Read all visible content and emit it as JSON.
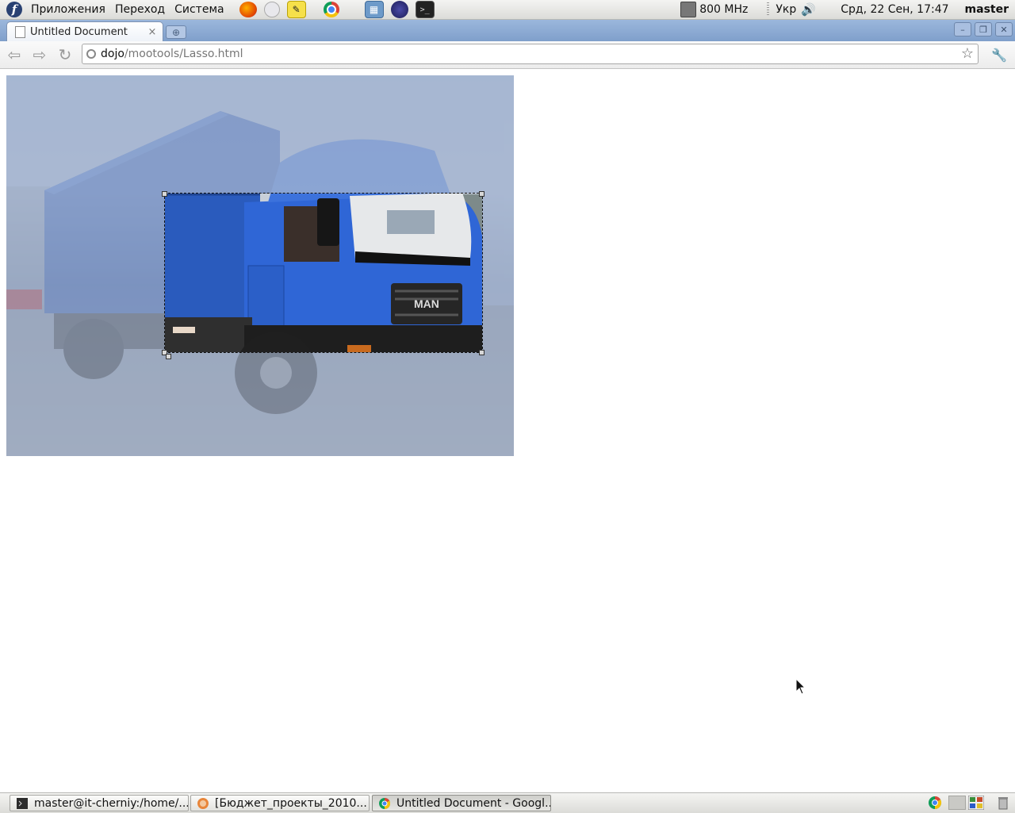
{
  "top_panel": {
    "menus": [
      "Приложения",
      "Переход",
      "Система"
    ],
    "launchers": [
      "firefox-icon",
      "mail-icon",
      "notes-icon",
      "chrome-icon",
      "system-monitor-icon",
      "eclipse-icon",
      "terminal-icon"
    ],
    "cpu_freq": "800 MHz",
    "keyboard_layout": "Укр",
    "datetime": "Срд, 22 Сен, 17:47",
    "user": "master"
  },
  "browser": {
    "tab_title": "Untitled Document",
    "url_host": "dojo",
    "url_path": "/mootools/Lasso.html"
  },
  "page": {
    "image_subject": "blue MAN truck photo with lasso crop selection",
    "truck_badge": "MAN"
  },
  "taskbar": {
    "tasks": [
      {
        "label": "master@it-cherniy:/home/...",
        "icon": "terminal-icon"
      },
      {
        "label": "[Бюджет_проекты_2010...",
        "icon": "firefox-icon"
      },
      {
        "label": "Untitled Document - Googl...",
        "icon": "chrome-icon"
      }
    ]
  },
  "colors": {
    "panel": "#dcdcd8",
    "tabstrip": "#8fabd4",
    "truck_blue": "#2f63c4",
    "overlay": "#a9b8d4"
  }
}
